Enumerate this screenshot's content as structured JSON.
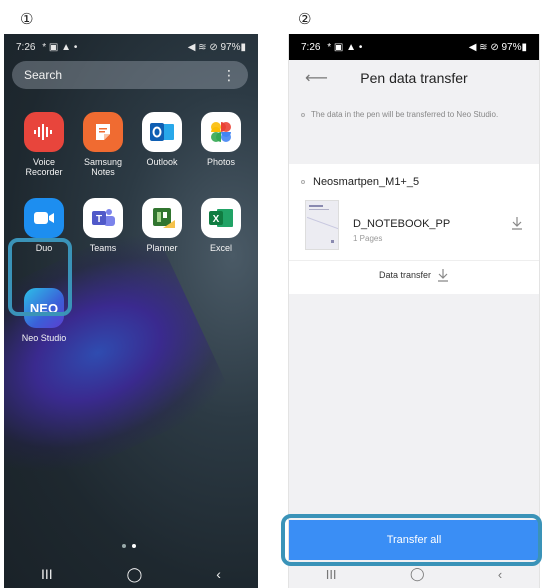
{
  "steps": {
    "first": "①",
    "second": "②"
  },
  "left_phone": {
    "status": {
      "time": "7:26",
      "left_icons": "* ▣ ▲ •",
      "right_icons": "◀ ≋ ⊘ 97%▮"
    },
    "search": {
      "label": "Search",
      "menu_icon": "⋮"
    },
    "apps": [
      {
        "label": "Voice\nRecorder",
        "color": "#e8453c",
        "icon": "voice-recorder-icon"
      },
      {
        "label": "Samsung\nNotes",
        "color": "#f06b31",
        "icon": "samsung-notes-icon"
      },
      {
        "label": "Outlook",
        "color": "#1b6fc7",
        "icon": "outlook-icon"
      },
      {
        "label": "Photos",
        "color": "#ffffff",
        "icon": "photos-icon"
      },
      {
        "label": "Duo",
        "color": "#1d8ef0",
        "icon": "duo-icon"
      },
      {
        "label": "Teams",
        "color": "#ffffff",
        "icon": "teams-icon"
      },
      {
        "label": "Planner",
        "color": "#ffffff",
        "icon": "planner-icon"
      },
      {
        "label": "Excel",
        "color": "#ffffff",
        "icon": "excel-icon"
      },
      {
        "label": "Neo Studio",
        "color": "#3b6fd8",
        "icon": "neo-studio-icon"
      }
    ],
    "nav": {
      "recents": "III",
      "home": "◯",
      "back": "‹"
    }
  },
  "right_phone": {
    "status": {
      "time": "7:26",
      "left_icons": "* ▣ ▲ •",
      "right_icons": "◀ ≋ ⊘ 97%▮"
    },
    "title": "Pen data transfer",
    "info": "The data in the pen will be transferred to Neo Studio.",
    "pen_name": "Neosmartpen_M1+_5",
    "notebook": {
      "title": "D_NOTEBOOK_PP",
      "pages": "1 Pages"
    },
    "data_transfer": "Data transfer",
    "transfer_all": "Transfer all",
    "nav": {
      "recents": "III",
      "home": "◯",
      "back": "‹"
    }
  },
  "colors": {
    "highlight": "#3a93b8",
    "accent": "#3a8ef5"
  }
}
